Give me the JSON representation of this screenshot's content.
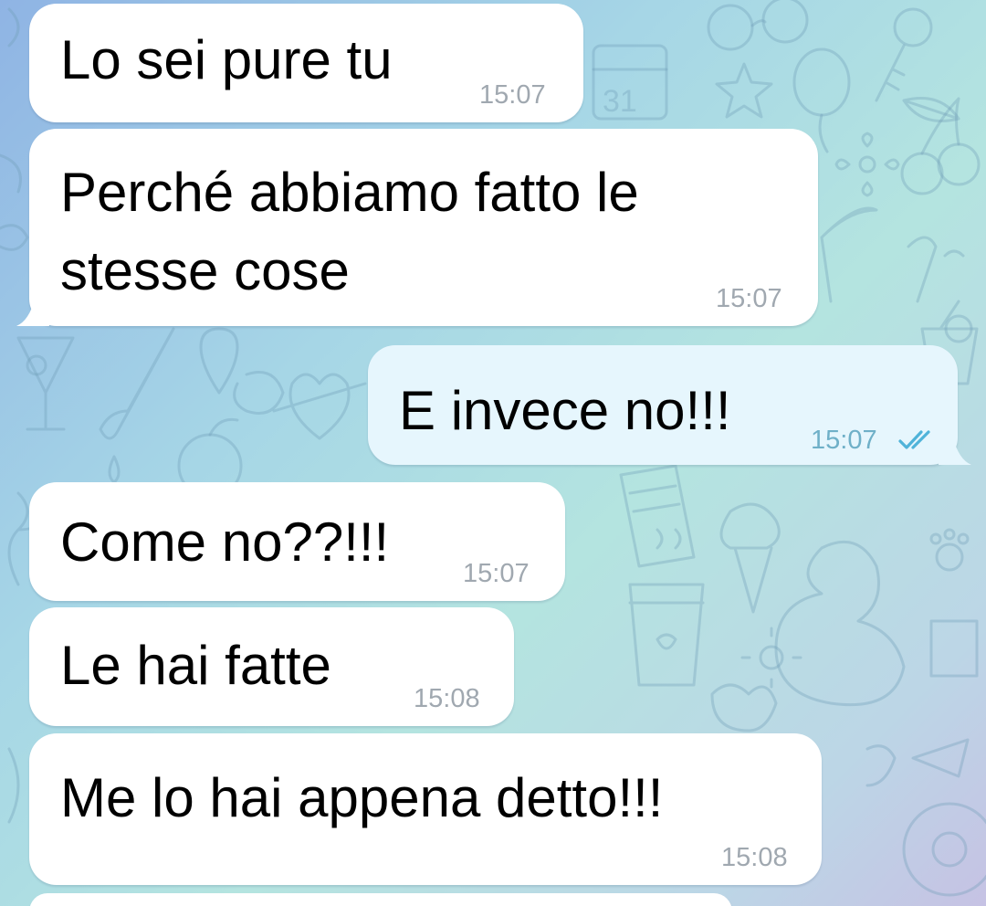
{
  "messages": [
    {
      "direction": "in",
      "text": "Lo sei pure tu",
      "time": "15:07"
    },
    {
      "direction": "in",
      "lines": [
        "Perché abbiamo fatto le",
        "stesse cose"
      ],
      "time": "15:07"
    },
    {
      "direction": "out",
      "text": "E invece no!!!",
      "time": "15:07",
      "status_icon": "double-check-icon"
    },
    {
      "direction": "in",
      "text": "Come no??!!!",
      "time": "15:07"
    },
    {
      "direction": "in",
      "text": "Le hai fatte",
      "time": "15:08"
    },
    {
      "direction": "in",
      "text": "Me lo hai appena detto!!!",
      "time": "15:08"
    }
  ],
  "colors": {
    "incoming_bubble": "#ffffff",
    "outgoing_bubble": "#e6f6fd",
    "read_check": "#4fb3d9",
    "timestamp": "#a0a8b0"
  }
}
